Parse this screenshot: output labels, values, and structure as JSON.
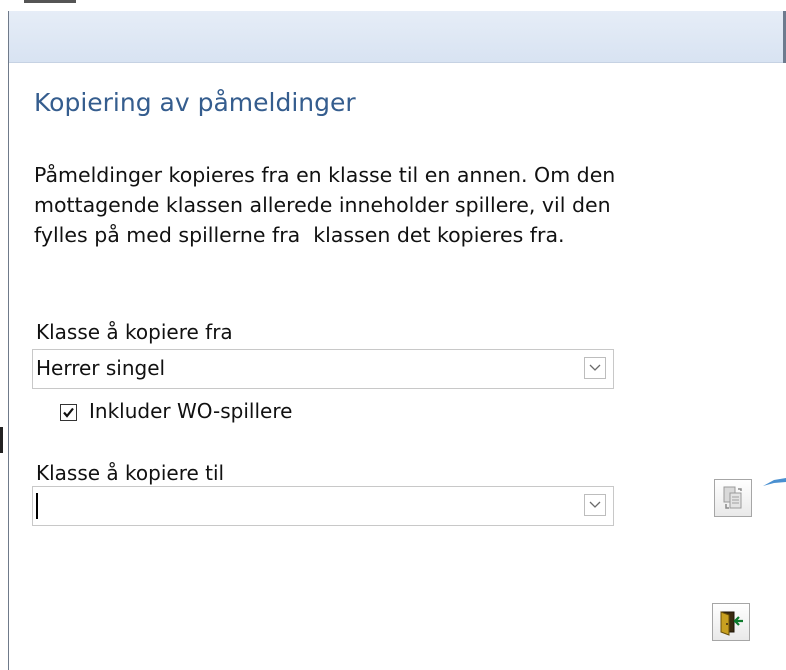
{
  "form": {
    "title": "Kopiering av påmeldinger",
    "description": "Påmeldinger kopieres fra en klasse til en annen. Om den\nmottagende klassen allerede inneholder spillere, vil den\nfylles på med spillerne fra  klassen det kopieres fra.",
    "from_label": "Klasse å kopiere fra",
    "from_value": "Herrer singel",
    "include_wo_label": "Inkluder WO-spillere",
    "include_wo_checked": true,
    "to_label": "Klasse å kopiere til",
    "to_value": ""
  },
  "icons": {
    "from_dropdown": "chevron-down-icon",
    "to_dropdown": "chevron-down-icon",
    "copy_button": "copy-entries-icon",
    "exit_button": "exit-door-icon",
    "pointer": "callout-arrow-icon"
  },
  "colors": {
    "title": "#355d8e",
    "titlebar": "#dde6f3"
  }
}
